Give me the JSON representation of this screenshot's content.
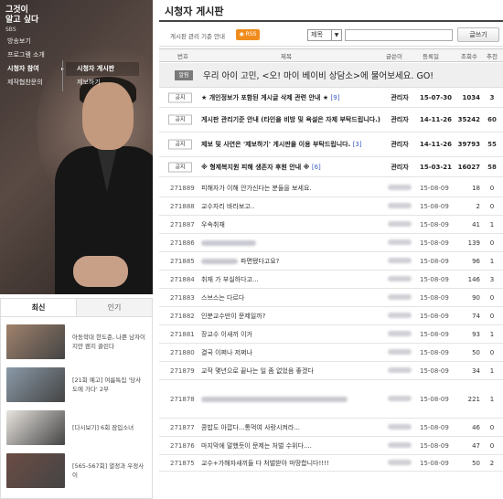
{
  "program": {
    "title_line1": "그것이",
    "title_line2": "알고 싶다",
    "network": "SBS"
  },
  "nav": [
    {
      "label": "방송보기",
      "active": false
    },
    {
      "label": "프로그램 소개",
      "active": false
    },
    {
      "label": "시청자 참여",
      "active": true
    },
    {
      "label": "제작협찬문의",
      "active": false
    }
  ],
  "subnav": [
    {
      "label": "시청자 게시판",
      "active": true
    },
    {
      "label": "제보하기",
      "active": false
    }
  ],
  "tabs": [
    {
      "label": "최신",
      "active": true
    },
    {
      "label": "인기",
      "active": false
    }
  ],
  "news": [
    {
      "text": "아동학대 한도준, 나쁜 남자이지만 왠지 끌린다",
      "color": "#a0826c"
    },
    {
      "text": "[21회 예고] 여름특집 '당사도에 가다' 2부",
      "color": "#8a9aa8"
    },
    {
      "text": "[다시보기] 6회 잠입소녀",
      "color": "#e8e4df"
    },
    {
      "text": "[565-567회] 열정과 우정사이",
      "color": "#6c4c44"
    }
  ],
  "board": {
    "title": "시청자 게시판",
    "guide": "게시판 관리 기준 안내",
    "rss": "RSS",
    "search_field": "제목",
    "write_button": "글쓰기",
    "columns": {
      "num": "번호",
      "title": "제목",
      "author": "글쓴이",
      "date": "등록일",
      "views": "조회수",
      "rec": "추천"
    }
  },
  "notice": {
    "badge": "알림",
    "text": "우리 아이 고민, <오! 마이 베이비 상담소>에 물어보세요. GO!"
  },
  "pinned": [
    {
      "badge": "공지",
      "title": "★ 개인정보가 포함된 게시글 삭제 관련 안내 ★",
      "comments": "[9]",
      "author": "관리자",
      "date": "15-07-30",
      "views": "1034",
      "rec": "3"
    },
    {
      "badge": "공지",
      "title": "게시판 관리기준 안내 (타인을 비방 및 욕설은 자제 부탁드립니다.)",
      "comments": "",
      "author": "관리자",
      "date": "14-11-26",
      "views": "35242",
      "rec": "60"
    },
    {
      "badge": "공지",
      "title": "제보 및 사연은 '제보하기' 게시판을 이용 부탁드립니다.",
      "comments": "[3]",
      "author": "관리자",
      "date": "14-11-26",
      "views": "39793",
      "rec": "55"
    },
    {
      "badge": "공지",
      "title": "※ 형제복지원 피해 생존자 후원 안내 ※",
      "comments": "[6]",
      "author": "관리자",
      "date": "15-03-21",
      "views": "16027",
      "rec": "58"
    }
  ],
  "posts": [
    {
      "num": "271889",
      "title": "피해자가 이해 안가신다는 분들을 보세요.",
      "blurw": 0,
      "date": "15-08-09",
      "views": "18",
      "rec": "0"
    },
    {
      "num": "271888",
      "title": "교수자리 바라보고..",
      "blurw": 0,
      "date": "15-08-09",
      "views": "2",
      "rec": "0"
    },
    {
      "num": "271887",
      "title": "우속취재",
      "blurw": 0,
      "date": "15-08-09",
      "views": "41",
      "rec": "1"
    },
    {
      "num": "271886",
      "title": "",
      "blurw": 60,
      "date": "15-08-09",
      "views": "139",
      "rec": "0"
    },
    {
      "num": "271885",
      "title": "파면됐다고요?",
      "blurw": 40,
      "date": "15-08-09",
      "views": "96",
      "rec": "1"
    },
    {
      "num": "271884",
      "title": "취재 가 부실하다고...",
      "blurw": 0,
      "date": "15-08-09",
      "views": "146",
      "rec": "3"
    },
    {
      "num": "271883",
      "title": "스브스는 다르다",
      "blurw": 0,
      "date": "15-08-09",
      "views": "90",
      "rec": "0"
    },
    {
      "num": "271882",
      "title": "인분교수만이 문제일까?",
      "blurw": 0,
      "date": "15-08-09",
      "views": "74",
      "rec": "0"
    },
    {
      "num": "271881",
      "title": "장교수 이새끼 이거",
      "blurw": 0,
      "date": "15-08-09",
      "views": "93",
      "rec": "1"
    },
    {
      "num": "271880",
      "title": "결국 이쩌나 저쩌나",
      "blurw": 0,
      "date": "15-08-09",
      "views": "50",
      "rec": "0"
    },
    {
      "num": "271879",
      "title": "교작 몇년으로 끝나는 일 좀 없었음 좋겠다",
      "blurw": 0,
      "date": "15-08-09",
      "views": "34",
      "rec": "1"
    },
    {
      "num": "271878",
      "title": "",
      "blurw": 160,
      "date": "15-08-09",
      "views": "221",
      "rec": "1"
    },
    {
      "num": "271877",
      "title": "콩밥도 아깝다...통먹여 사랑시켜라...",
      "blurw": 0,
      "date": "15-08-09",
      "views": "46",
      "rec": "0"
    },
    {
      "num": "271876",
      "title": "마지막에 말했듯이 문제는 처벌 수위다....",
      "blurw": 0,
      "date": "15-08-09",
      "views": "47",
      "rec": "0"
    },
    {
      "num": "271875",
      "title": "교수+가해자새끼들 다 처벌받아 마땅합니다!!!!",
      "blurw": 0,
      "date": "15-08-09",
      "views": "50",
      "rec": "2"
    }
  ]
}
